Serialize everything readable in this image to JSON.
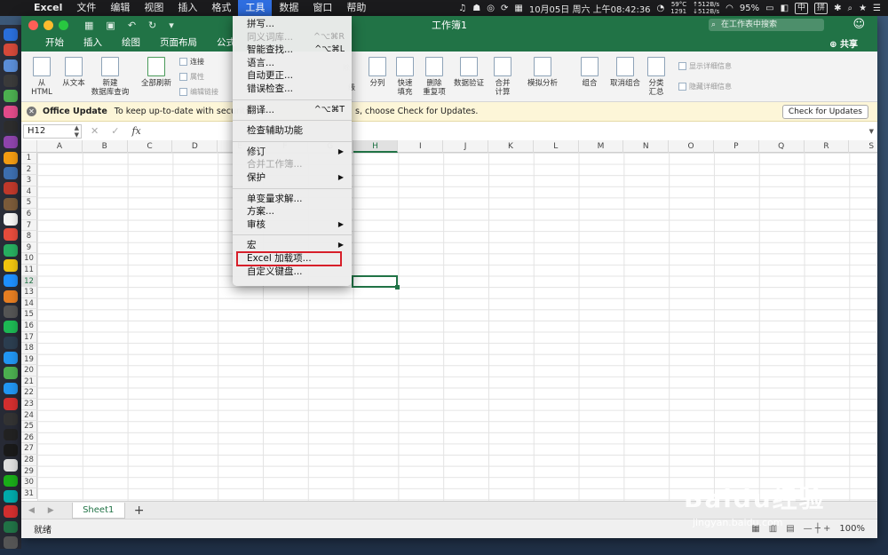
{
  "menubar": {
    "app_name": "Excel",
    "items": [
      "文件",
      "编辑",
      "视图",
      "插入",
      "格式",
      "工具",
      "数据",
      "窗口",
      "帮助"
    ],
    "active_item": "工具",
    "temp": "59°C",
    "cpu_num": "1291",
    "net_up": "↑512B/s",
    "net_down": "↓512B/s",
    "battery": "95%",
    "ime": "中",
    "ime2": "拼",
    "datetime": "10月05日 周六 上午08:42:36"
  },
  "window": {
    "title": "工作簿1",
    "search_placeholder": "在工作表中搜索",
    "share_label": "共享",
    "tabs": [
      "开始",
      "插入",
      "绘图",
      "页面布局",
      "公式"
    ]
  },
  "ribbon": {
    "from_html": "从\nHTML",
    "from_text": "从文本",
    "new_db_query": "新建\n数据库查询",
    "refresh_all": "全部刷新",
    "connections": "连接",
    "properties": "属性",
    "edit_links": "编辑链接",
    "advanced_partial": "级",
    "delete_partial": "除",
    "split": "分列",
    "flash_fill": "快速\n填充",
    "remove_dup": "删除\n重复项",
    "data_validation": "数据验证",
    "consolidate": "合并\n计算",
    "what_if": "模拟分析",
    "group": "组合",
    "ungroup": "取消组合",
    "subtotal": "分类\n汇总",
    "show_detail": "显示详细信息",
    "hide_detail": "隐藏详细信息"
  },
  "infobar": {
    "title": "Office Update",
    "message_left": "To keep up-to-date with security up",
    "message_right": "s, choose Check for Updates.",
    "button": "Check for Updates"
  },
  "formula_bar": {
    "name_box": "H12",
    "fx": "fx"
  },
  "grid": {
    "columns": [
      "A",
      "B",
      "C",
      "D",
      "E",
      "F",
      "G",
      "H",
      "I",
      "J",
      "K",
      "L",
      "M",
      "N",
      "O",
      "P",
      "Q",
      "R",
      "S"
    ],
    "rows": [
      "1",
      "2",
      "3",
      "4",
      "5",
      "6",
      "7",
      "8",
      "9",
      "10",
      "11",
      "12",
      "13",
      "14",
      "15",
      "16",
      "17",
      "18",
      "19",
      "20",
      "21",
      "22",
      "23",
      "24",
      "25",
      "26",
      "27",
      "28",
      "29",
      "30",
      "31"
    ],
    "selected_column": "H",
    "selected_row": "12"
  },
  "sheets": {
    "tabs": [
      "Sheet1"
    ],
    "add": "+"
  },
  "status": {
    "ready": "就绪",
    "zoom": "100%"
  },
  "tools_menu": [
    {
      "label": "拼写...",
      "disabled": false,
      "shortcut": ""
    },
    {
      "label": "同义词库...",
      "disabled": true,
      "shortcut": "^⌥⌘R"
    },
    {
      "label": "智能查找...",
      "disabled": false,
      "shortcut": "^⌥⌘L"
    },
    {
      "label": "语言...",
      "disabled": false,
      "shortcut": ""
    },
    {
      "label": "自动更正...",
      "disabled": false,
      "shortcut": ""
    },
    {
      "label": "错误检查...",
      "disabled": false,
      "shortcut": ""
    },
    {
      "sep": true
    },
    {
      "label": "翻译...",
      "disabled": false,
      "shortcut": "^⌥⌘T"
    },
    {
      "sep": true
    },
    {
      "label": "检查辅助功能",
      "disabled": false,
      "shortcut": ""
    },
    {
      "sep": true
    },
    {
      "label": "修订",
      "disabled": false,
      "submenu": true
    },
    {
      "label": "合并工作簿...",
      "disabled": true,
      "shortcut": ""
    },
    {
      "label": "保护",
      "disabled": false,
      "submenu": true
    },
    {
      "sep": true
    },
    {
      "label": "单变量求解...",
      "disabled": false,
      "shortcut": ""
    },
    {
      "label": "方案...",
      "disabled": false,
      "shortcut": ""
    },
    {
      "label": "审核",
      "disabled": false,
      "submenu": true
    },
    {
      "sep": true
    },
    {
      "label": "宏",
      "disabled": false,
      "submenu": true
    },
    {
      "label": "Excel 加载项...",
      "disabled": false,
      "highlighted": true
    },
    {
      "label": "自定义键盘...",
      "disabled": false,
      "shortcut": ""
    }
  ],
  "watermark": {
    "text": "Baidu经验",
    "url": "jingyan.baidu.com"
  },
  "colors": {
    "excel_green": "#217346",
    "highlight_red": "#d71f2a",
    "menu_active_blue": "#2f6ee0"
  }
}
